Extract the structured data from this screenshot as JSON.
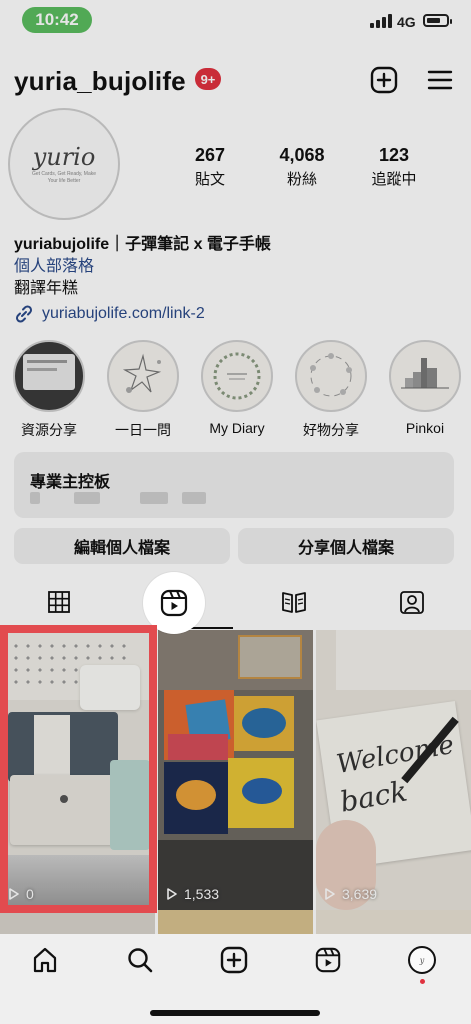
{
  "status_bar": {
    "time": "10:42",
    "network": "4G"
  },
  "header": {
    "username": "yuria_bujolife",
    "notification_badge": "9+"
  },
  "avatar": {
    "logo_text": "yurio",
    "tagline": "Get Cards, Get Ready, Make Your life Better"
  },
  "stats": [
    {
      "value": "267",
      "label": "貼文"
    },
    {
      "value": "4,068",
      "label": "粉絲"
    },
    {
      "value": "123",
      "label": "追蹤中"
    }
  ],
  "bio": {
    "name": "yuriabujolife｜子彈筆記 x 電子手帳",
    "category": "個人部落格",
    "text": "翻譯年糕",
    "link": "yuriabujolife.com/link-2"
  },
  "highlights": [
    {
      "label": "資源分享"
    },
    {
      "label": "一日一問"
    },
    {
      "label": "My Diary"
    },
    {
      "label": "好物分享"
    },
    {
      "label": "Pinkoi"
    }
  ],
  "dashboard": {
    "title": "專業主控板"
  },
  "profile_buttons": {
    "edit": "編輯個人檔案",
    "share": "分享個人檔案"
  },
  "reels": [
    {
      "views": "0"
    },
    {
      "views": "1,533"
    },
    {
      "views": "3,639"
    }
  ],
  "colors": {
    "accent_red": "#e0323f",
    "highlight_box": "#e24b4f",
    "link_blue": "#2b4a8a",
    "status_green": "#5bbd5f"
  },
  "icons": {
    "tabs": [
      "grid-icon",
      "reels-icon",
      "guide-icon",
      "tagged-icon"
    ],
    "nav": [
      "home-icon",
      "search-icon",
      "create-icon",
      "reels-icon",
      "profile-avatar"
    ]
  }
}
